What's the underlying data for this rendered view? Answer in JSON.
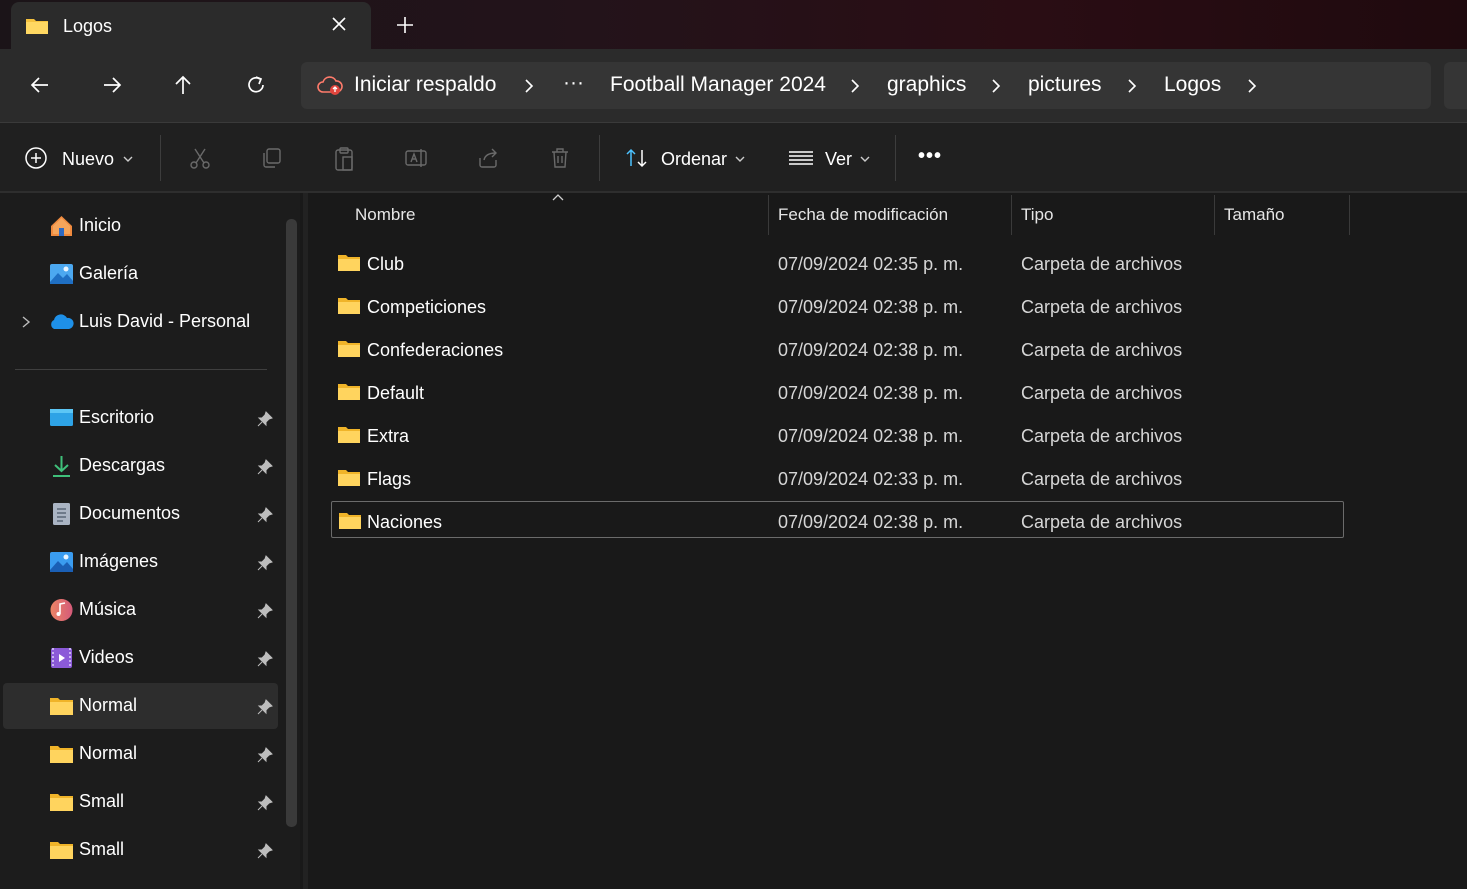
{
  "window": {
    "tab_title": "Logos",
    "new_tab_glyph": "+",
    "close_glyph": "✕"
  },
  "nav": {
    "back_icon": "arrow-left-icon",
    "forward_icon": "arrow-right-icon",
    "up_icon": "arrow-up-icon",
    "refresh_icon": "refresh-icon"
  },
  "breadcrumb": {
    "backup_label": "Iniciar respaldo",
    "overflow_label": "···",
    "items": [
      "Football Manager 2024",
      "graphics",
      "pictures",
      "Logos"
    ]
  },
  "toolbar": {
    "new_label": "Nuevo",
    "sort_label": "Ordenar",
    "view_label": "Ver",
    "more_label": "•••"
  },
  "sidebar": {
    "top_items": [
      {
        "label": "Inicio",
        "icon": "home-icon"
      },
      {
        "label": "Galería",
        "icon": "gallery-icon"
      },
      {
        "label": "Luis David - Personal",
        "icon": "onedrive-icon"
      }
    ],
    "pinned_items": [
      {
        "label": "Escritorio",
        "icon": "desktop-icon"
      },
      {
        "label": "Descargas",
        "icon": "download-icon"
      },
      {
        "label": "Documentos",
        "icon": "document-icon"
      },
      {
        "label": "Imágenes",
        "icon": "pictures-icon"
      },
      {
        "label": "Música",
        "icon": "music-icon"
      },
      {
        "label": "Videos",
        "icon": "videos-icon"
      },
      {
        "label": "Normal",
        "icon": "folder-icon"
      },
      {
        "label": "Normal",
        "icon": "folder-icon"
      },
      {
        "label": "Small",
        "icon": "folder-icon"
      },
      {
        "label": "Small",
        "icon": "folder-icon"
      }
    ]
  },
  "filelist": {
    "columns": [
      "Nombre",
      "Fecha de modificación",
      "Tipo",
      "Tamaño"
    ],
    "rows": [
      {
        "name": "Club",
        "date": "07/09/2024 02:35 p. m.",
        "type": "Carpeta de archivos"
      },
      {
        "name": "Competiciones",
        "date": "07/09/2024 02:38 p. m.",
        "type": "Carpeta de archivos"
      },
      {
        "name": "Confederaciones",
        "date": "07/09/2024 02:38 p. m.",
        "type": "Carpeta de archivos"
      },
      {
        "name": "Default",
        "date": "07/09/2024 02:38 p. m.",
        "type": "Carpeta de archivos"
      },
      {
        "name": "Extra",
        "date": "07/09/2024 02:38 p. m.",
        "type": "Carpeta de archivos"
      },
      {
        "name": "Flags",
        "date": "07/09/2024 02:33 p. m.",
        "type": "Carpeta de archivos"
      },
      {
        "name": "Naciones",
        "date": "07/09/2024 02:38 p. m.",
        "type": "Carpeta de archivos"
      }
    ]
  },
  "colors": {
    "folder": "#f5c23e",
    "accent": "#4cc2ff",
    "background": "#191919"
  }
}
